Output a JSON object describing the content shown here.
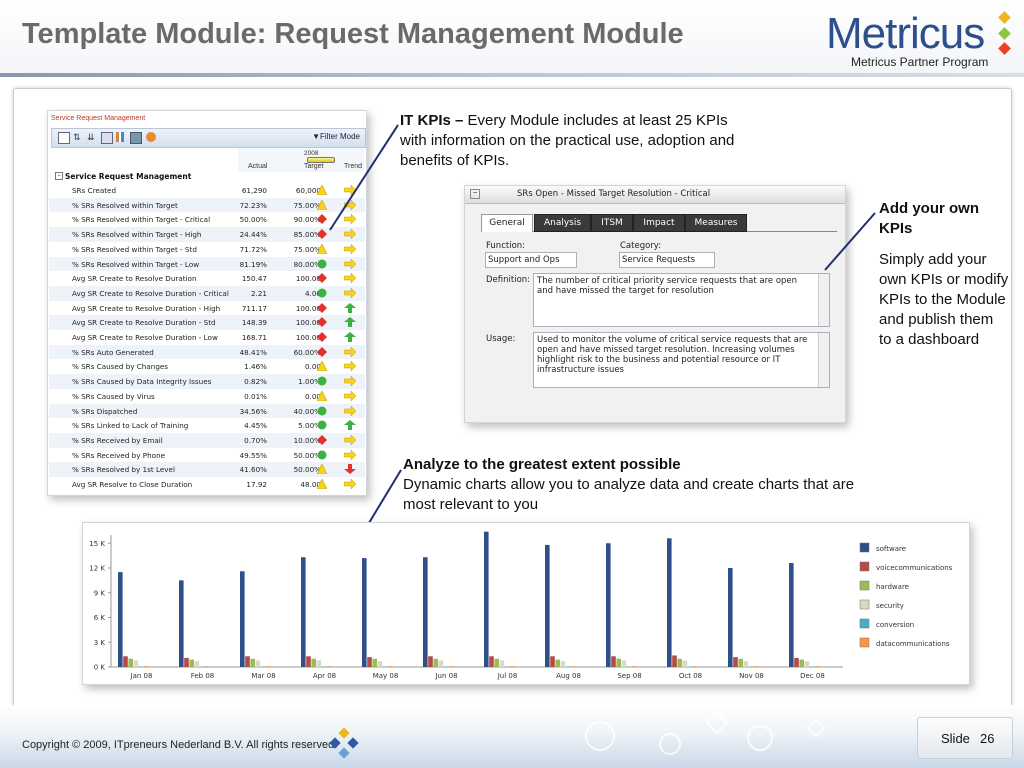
{
  "header": {
    "title": "Template Module: Request Management Module",
    "logo_text": "Metricus",
    "logo_subtitle": "Metricus Partner Program"
  },
  "kpi_panel": {
    "link": "Service Request Management",
    "filter_mode": "Filter Mode",
    "year": "2008",
    "col_actual": "Actual",
    "col_target": "Target",
    "col_trend": "Trend",
    "group": "Service Request Management",
    "rows": [
      {
        "name": "SRs Created",
        "actual": "61,290",
        "target": "60,000",
        "status": "yellow",
        "trend": "right"
      },
      {
        "name": "% SRs Resolved within Target",
        "actual": "72.23%",
        "target": "75.00%",
        "status": "yellow",
        "trend": "right"
      },
      {
        "name": "% SRs Resolved within Target - Critical",
        "actual": "50.00%",
        "target": "90.00%",
        "status": "red",
        "trend": "right"
      },
      {
        "name": "% SRs Resolved within Target - High",
        "actual": "24.44%",
        "target": "85.00%",
        "status": "red",
        "trend": "right"
      },
      {
        "name": "% SRs Resolved within Target - Std",
        "actual": "71.72%",
        "target": "75.00%",
        "status": "yellow",
        "trend": "right"
      },
      {
        "name": "% SRs Resolved within Target - Low",
        "actual": "81.19%",
        "target": "80.00%",
        "status": "green",
        "trend": "right"
      },
      {
        "name": "Avg SR Create to Resolve Duration",
        "actual": "150.47",
        "target": "100.00",
        "status": "red",
        "trend": "right"
      },
      {
        "name": "Avg SR Create to Resolve Duration - Critical",
        "actual": "2.21",
        "target": "4.00",
        "status": "green",
        "trend": "right"
      },
      {
        "name": "Avg SR Create to Resolve Duration - High",
        "actual": "711.17",
        "target": "100.00",
        "status": "red",
        "trend": "up"
      },
      {
        "name": "Avg SR Create to Resolve Duration - Std",
        "actual": "148.39",
        "target": "100.00",
        "status": "red",
        "trend": "up"
      },
      {
        "name": "Avg SR Create to Resolve Duration - Low",
        "actual": "168.71",
        "target": "100.00",
        "status": "red",
        "trend": "up"
      },
      {
        "name": "% SRs Auto Generated",
        "actual": "48.41%",
        "target": "60.00%",
        "status": "red",
        "trend": "right"
      },
      {
        "name": "% SRs Caused by Changes",
        "actual": "1.46%",
        "target": "0.00",
        "status": "yellow",
        "trend": "right"
      },
      {
        "name": "% SRs Caused by Data Integrity Issues",
        "actual": "0.82%",
        "target": "1.00%",
        "status": "green",
        "trend": "right"
      },
      {
        "name": "% SRs Caused by Virus",
        "actual": "0.01%",
        "target": "0.00",
        "status": "yellow",
        "trend": "right"
      },
      {
        "name": "% SRs Dispatched",
        "actual": "34.56%",
        "target": "40.00%",
        "status": "green",
        "trend": "right"
      },
      {
        "name": "% SRs Linked to Lack of Training",
        "actual": "4.45%",
        "target": "5.00%",
        "status": "green",
        "trend": "up"
      },
      {
        "name": "% SRs Received by Email",
        "actual": "0.70%",
        "target": "10.00%",
        "status": "red",
        "trend": "right"
      },
      {
        "name": "% SRs Received by Phone",
        "actual": "49.55%",
        "target": "50.00%",
        "status": "green",
        "trend": "right"
      },
      {
        "name": "% SRs Resolved by 1st Level",
        "actual": "41.60%",
        "target": "50.00%",
        "status": "yellow",
        "trend": "down"
      },
      {
        "name": "Avg SR Resolve to Close Duration",
        "actual": "17.92",
        "target": "48.00",
        "status": "yellow",
        "trend": "right"
      }
    ]
  },
  "notes": {
    "it_kpis_bold": "IT KPIs –",
    "it_kpis_text": " Every Module includes at least 25 KPIs with information on the practical use, adoption and benefits of KPIs.",
    "add_heading": "Add your own KPIs",
    "add_text": "Simply add your own KPIs or modify KPIs to the Module and publish them to a dashboard",
    "analyze_heading": "Analyze to the greatest extent possible",
    "analyze_text": "Dynamic charts allow you to analyze data and create charts that are most relevant to you"
  },
  "detail_panel": {
    "title": "SRs Open - Missed Target Resolution - Critical",
    "tabs": [
      "General",
      "Analysis",
      "ITSM",
      "Impact",
      "Measures"
    ],
    "function_label": "Function:",
    "function_value": "Support and Ops",
    "category_label": "Category:",
    "category_value": "Service Requests",
    "definition_label": "Definition:",
    "definition_text": "The number of critical priority service requests that are open and have missed the target for resolution",
    "usage_label": "Usage:",
    "usage_text": "Used to monitor the volume of critical service requests that are open and have missed target resolution. Increasing volumes highlight risk to the business and potential resource or IT infrastructure issues"
  },
  "chart_data": {
    "type": "bar",
    "categories": [
      "Jan 08",
      "Feb 08",
      "Mar 08",
      "Apr 08",
      "May 08",
      "Jun 08",
      "Jul 08",
      "Aug 08",
      "Sep 08",
      "Oct 08",
      "Nov 08",
      "Dec 08"
    ],
    "ylim": [
      0,
      16000
    ],
    "yticks": [
      0,
      3000,
      6000,
      9000,
      12000,
      15000
    ],
    "ytick_labels": [
      "0 K",
      "3 K",
      "6 K",
      "9 K",
      "12 K",
      "15 K"
    ],
    "legend_position": "right",
    "series": [
      {
        "name": "software",
        "color": "#2e4f87",
        "values": [
          11500,
          10500,
          11600,
          13300,
          13200,
          13300,
          16400,
          14800,
          15000,
          15600,
          12000,
          12600
        ]
      },
      {
        "name": "voicecommunications",
        "color": "#b34b47",
        "values": [
          1300,
          1100,
          1300,
          1300,
          1200,
          1300,
          1300,
          1300,
          1300,
          1400,
          1200,
          1100
        ]
      },
      {
        "name": "hardware",
        "color": "#9bbb59",
        "values": [
          1000,
          900,
          1000,
          1000,
          1000,
          1000,
          1000,
          900,
          1000,
          1000,
          1000,
          900
        ]
      },
      {
        "name": "security",
        "color": "#ddd8c4",
        "values": [
          800,
          700,
          800,
          800,
          700,
          800,
          800,
          700,
          800,
          800,
          700,
          700
        ]
      },
      {
        "name": "conversion",
        "color": "#4bacc6",
        "values": [
          60,
          60,
          60,
          60,
          60,
          60,
          60,
          60,
          60,
          60,
          60,
          60
        ]
      },
      {
        "name": "datacommunications",
        "color": "#f79646",
        "values": [
          100,
          100,
          100,
          100,
          100,
          100,
          100,
          100,
          100,
          100,
          100,
          100
        ]
      }
    ]
  },
  "footer": {
    "copyright": "Copyright © 2009, ITpreneurs Nederland B.V. All rights reserved.",
    "slide_label": "Slide",
    "slide_number": "26"
  }
}
